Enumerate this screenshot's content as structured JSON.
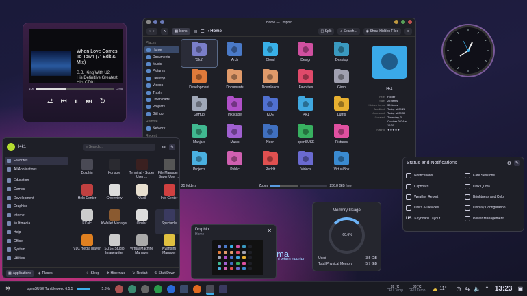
{
  "player": {
    "title": "When Love Comes To Town (7\" Edit & Mix)",
    "artist": "B.B. King With U2",
    "album": "His Definitive Greatest Hits CD01",
    "elapsed": "1:09",
    "remaining": "-2:05",
    "progress": 0.38
  },
  "dolphin": {
    "title": "Home — Dolphin",
    "view_icons": "Icons",
    "breadcrumb": "Home",
    "split": "Split",
    "search": "Search...",
    "hidden": "Show Hidden Files",
    "places_heading": "Places",
    "remote_heading": "Remote",
    "recent_heading": "Recent",
    "places": [
      "Home",
      "Documents",
      "Music",
      "Pictures",
      "Desktop",
      "Videos",
      "Trash",
      "Downloads",
      "Projects",
      "GitHub"
    ],
    "remote": [
      "Network"
    ],
    "items": [
      {
        "name": "\"Slot\"",
        "color": "#7a7ec8"
      },
      {
        "name": "Arch",
        "color": "#4a7ac8"
      },
      {
        "name": "Cloud",
        "color": "#38b0e8"
      },
      {
        "name": "Design",
        "color": "#d050a0"
      },
      {
        "name": "Desktop",
        "color": "#3a9ac0"
      },
      {
        "name": "",
        "color": "#1e1f26"
      },
      {
        "name": "Development",
        "color": "#e07a3a"
      },
      {
        "name": "Documents",
        "color": "#e09a6a"
      },
      {
        "name": "Downloads",
        "color": "#e09a6a"
      },
      {
        "name": "Favorites",
        "color": "#e04a6a"
      },
      {
        "name": "Gimp",
        "color": "#a0a0b0"
      },
      {
        "name": "",
        "color": "#1e1f26"
      },
      {
        "name": "GitHub",
        "color": "#a0a8b8"
      },
      {
        "name": "Inkscape",
        "color": "#b050c8"
      },
      {
        "name": "KDE",
        "color": "#5070d0"
      },
      {
        "name": "l4k1",
        "color": "#40a8e0"
      },
      {
        "name": "Lutris",
        "color": "#e8b030"
      },
      {
        "name": "",
        "color": "#1e1f26"
      },
      {
        "name": "Manjaro",
        "color": "#40b890"
      },
      {
        "name": "Music",
        "color": "#a060d0"
      },
      {
        "name": "Neon",
        "color": "#4070c0"
      },
      {
        "name": "openSUSE",
        "color": "#38b060"
      },
      {
        "name": "Pictures",
        "color": "#e050a0"
      },
      {
        "name": "",
        "color": "#1e1f26"
      },
      {
        "name": "Projects",
        "color": "#4ab0e0"
      },
      {
        "name": "Public",
        "color": "#d060b0"
      },
      {
        "name": "Reddit",
        "color": "#e05050"
      },
      {
        "name": "Videos",
        "color": "#6a6ad0"
      },
      {
        "name": "VirtualBox",
        "color": "#3a8ad0"
      },
      {
        "name": "",
        "color": "#1e1f26"
      }
    ],
    "info": {
      "name": "l4k1",
      "rows": [
        [
          "Type:",
          "Folder"
        ],
        [
          "Size:",
          "25 items"
        ],
        [
          "Hidden items:",
          "38 items"
        ],
        [
          "Modified:",
          "Today at 09:26"
        ],
        [
          "Accessed:",
          "Today at 09:30"
        ],
        [
          "Created:",
          "Thursday, 3 October 2024 at 15:30"
        ],
        [
          "Rating:",
          "★★★★★"
        ]
      ]
    },
    "status_left": "25 folders",
    "zoom_label": "Zoom:",
    "status_right": "256.8 GiB free"
  },
  "launcher": {
    "user": "l4k1",
    "search_placeholder": "Search...",
    "categories": [
      "Favorites",
      "All Applications",
      "Education",
      "Games",
      "Development",
      "Graphics",
      "Internet",
      "Multimedia",
      "Help",
      "Office",
      "System",
      "Utilities"
    ],
    "apps": [
      {
        "name": "Dolphin",
        "color": "#4a4a55"
      },
      {
        "name": "Konsole",
        "color": "#2a2a30"
      },
      {
        "name": "Terminal - Super User ...",
        "color": "#3a2020"
      },
      {
        "name": "File Manager - Super User ...",
        "color": "#555"
      },
      {
        "name": "Help Center",
        "color": "#c04040"
      },
      {
        "name": "Gwenview",
        "color": "#ddd"
      },
      {
        "name": "KMail",
        "color": "#e8e0d0"
      },
      {
        "name": "Info Center",
        "color": "#d04040"
      },
      {
        "name": "KCalc",
        "color": "#ccc"
      },
      {
        "name": "KWallet Manager",
        "color": "#8a5a30"
      },
      {
        "name": "Okular",
        "color": "#ddd"
      },
      {
        "name": "Spectacle",
        "color": "#3a3a60"
      },
      {
        "name": "VLC media player",
        "color": "#e08020"
      },
      {
        "name": "SUSE Studio Imagewriter",
        "color": "#ccc"
      },
      {
        "name": "Virtual Machine Manager",
        "color": "#aaa"
      },
      {
        "name": "Kvantum Manager",
        "color": "#e0c040"
      }
    ],
    "footer": {
      "applications": "Applications",
      "places": "Places",
      "sleep": "Sleep",
      "hibernate": "Hibernate",
      "restart": "Restart",
      "shutdown": "Shut Down"
    }
  },
  "preview": {
    "title": "Dolphin",
    "subtitle": "Home"
  },
  "wallpaper_text": {
    "big": "ma",
    "small": "ul when needed."
  },
  "memory": {
    "title": "Memory Usage",
    "percent": "60.6%",
    "fraction": 0.606,
    "used_label": "Used",
    "used": "3.5 GiB",
    "total_label": "Total Physical Memory",
    "total": "5.7 GiB"
  },
  "notifications": {
    "title": "Status and Notifications",
    "items": [
      "Notifications",
      "Kate Sessions",
      "Clipboard",
      "Disk Quota",
      "Weather Report",
      "Brightness and Color",
      "Disks & Devices",
      "Display Configuration",
      "Keyboard Layout",
      "Power Management"
    ],
    "keyboard_badge": "US"
  },
  "taskbar": {
    "distro": "openSUSE Tumbleweed 6.5.5",
    "cpu_pct": "5.6%",
    "cpu_temp": "39 °C",
    "cpu_label": "CPU Temp",
    "gpu_temp": "38 °C",
    "gpu_label": "GPU Temp",
    "weather": "11°",
    "time": "13:23",
    "accent": "#3daee9"
  }
}
